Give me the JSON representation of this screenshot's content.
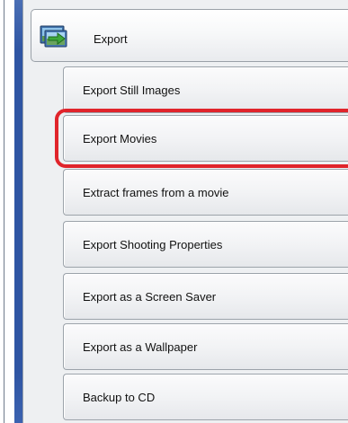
{
  "export_group": {
    "label": "Export",
    "icon": "export-images-icon"
  },
  "items": [
    {
      "label": "Export Still Images"
    },
    {
      "label": "Export Movies",
      "highlighted": true
    },
    {
      "label": "Extract frames from a movie"
    },
    {
      "label": "Export Shooting Properties"
    },
    {
      "label": "Export as a Screen Saver"
    },
    {
      "label": "Export as a Wallpaper"
    },
    {
      "label": "Backup to CD"
    }
  ],
  "colors": {
    "highlight": "#e0242b",
    "rail": "#2f55a3",
    "panel": "#eef0f2"
  }
}
